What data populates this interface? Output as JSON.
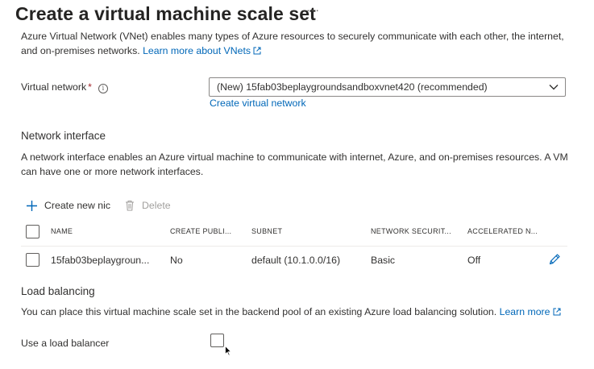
{
  "page": {
    "title": "Create a virtual machine scale set",
    "more_label": "···"
  },
  "vnet_section": {
    "intro_line1": "Azure Virtual Network (VNet) enables many types of Azure resources to securely communicate with each other, the internet,",
    "intro_line2": "and on-premises networks.",
    "learn_more": "Learn more about VNets",
    "label": "Virtual network",
    "required_mark": "*",
    "info_glyph": "i",
    "selected_value": "(New) 15fab03beplaygroundsandboxvnet420 (recommended)",
    "create_link": "Create virtual network"
  },
  "nic_section": {
    "heading": "Network interface",
    "description": "A network interface enables an Azure virtual machine to communicate with internet, Azure, and on-premises resources. A VM can have one or more network interfaces.",
    "create_label": "Create new nic",
    "delete_label": "Delete",
    "columns": [
      "NAME",
      "CREATE PUBLI...",
      "SUBNET",
      "NETWORK SECURIT...",
      "ACCELERATED N..."
    ],
    "rows": [
      {
        "name": "15fab03beplaygroun...",
        "create_public": "No",
        "subnet": "default (10.1.0.0/16)",
        "network_security": "Basic",
        "accelerated": "Off"
      }
    ]
  },
  "lb_section": {
    "heading": "Load balancing",
    "description": "You can place this virtual machine scale set in the backend pool of an existing Azure load balancing solution.",
    "learn_more": "Learn more",
    "use_label": "Use a load balancer",
    "use_checked": false
  },
  "colors": {
    "link": "#0067b8",
    "text": "#323130",
    "required": "#a4262c",
    "disabled": "#a19f9d",
    "border": "#8a8886"
  },
  "icons": {
    "more": "more-icon",
    "info": "info-icon",
    "external": "external-link-icon",
    "chevron": "chevron-down-icon",
    "add": "plus-icon",
    "delete": "trash-icon",
    "edit": "pencil-icon",
    "pointer": "mouse-cursor-icon"
  }
}
